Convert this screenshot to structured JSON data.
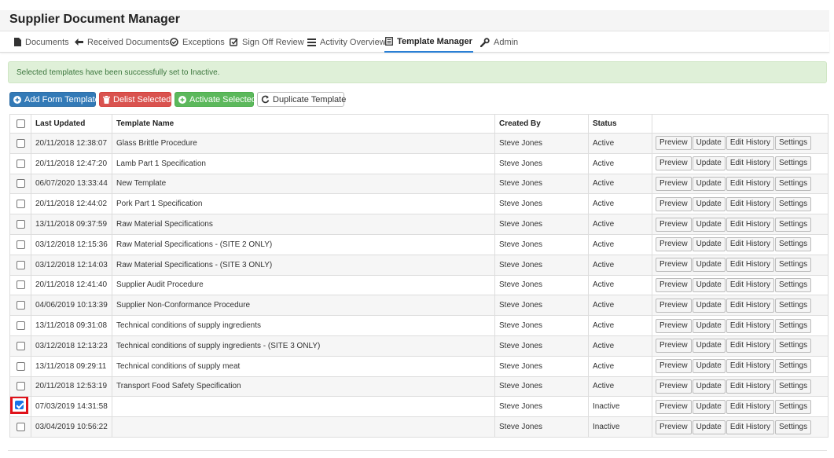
{
  "app": {
    "title": "Supplier Document Manager"
  },
  "nav": {
    "tabs": [
      {
        "label": "Documents",
        "icon": "file-icon"
      },
      {
        "label": "Received Documents",
        "icon": "arrow-left-icon"
      },
      {
        "label": "Exceptions",
        "icon": "circle-check-icon"
      },
      {
        "label": "Sign Off Review",
        "icon": "checkbox-icon"
      },
      {
        "label": "Activity Overview",
        "icon": "list-icon"
      },
      {
        "label": "Template Manager",
        "icon": "document-list-icon",
        "active": true
      },
      {
        "label": "Admin",
        "icon": "wrench-icon"
      }
    ]
  },
  "alert": {
    "message": "Selected templates have been successfully set to Inactive."
  },
  "toolbar": {
    "add_label": "Add Form Template",
    "delist_label": "Delist Selected",
    "activate_label": "Activate Selected",
    "duplicate_label": "Duplicate Template"
  },
  "table": {
    "headers": {
      "last_updated": "Last Updated",
      "template_name": "Template Name",
      "created_by": "Created By",
      "status": "Status"
    },
    "action_labels": {
      "preview": "Preview",
      "update": "Update",
      "edit_history": "Edit History",
      "settings": "Settings"
    },
    "rows": [
      {
        "checked": false,
        "last_updated": "20/11/2018 12:38:07",
        "template_name": "Glass Brittle Procedure",
        "created_by": "Steve Jones",
        "status": "Active"
      },
      {
        "checked": false,
        "last_updated": "20/11/2018 12:47:20",
        "template_name": "Lamb Part 1 Specification",
        "created_by": "Steve Jones",
        "status": "Active"
      },
      {
        "checked": false,
        "last_updated": "06/07/2020 13:33:44",
        "template_name": "New Template",
        "created_by": "Steve Jones",
        "status": "Active"
      },
      {
        "checked": false,
        "last_updated": "20/11/2018 12:44:02",
        "template_name": "Pork Part 1 Specification",
        "created_by": "Steve Jones",
        "status": "Active"
      },
      {
        "checked": false,
        "last_updated": "13/11/2018 09:37:59",
        "template_name": "Raw Material Specifications",
        "created_by": "Steve Jones",
        "status": "Active"
      },
      {
        "checked": false,
        "last_updated": "03/12/2018 12:15:36",
        "template_name": "Raw Material Specifications - (SITE 2 ONLY)",
        "created_by": "Steve Jones",
        "status": "Active"
      },
      {
        "checked": false,
        "last_updated": "03/12/2018 12:14:03",
        "template_name": "Raw Material Specifications - (SITE 3 ONLY)",
        "created_by": "Steve Jones",
        "status": "Active"
      },
      {
        "checked": false,
        "last_updated": "20/11/2018 12:41:40",
        "template_name": "Supplier Audit Procedure",
        "created_by": "Steve Jones",
        "status": "Active"
      },
      {
        "checked": false,
        "last_updated": "04/06/2019 10:13:39",
        "template_name": "Supplier Non-Conformance Procedure",
        "created_by": "Steve Jones",
        "status": "Active"
      },
      {
        "checked": false,
        "last_updated": "13/11/2018 09:31:08",
        "template_name": "Technical conditions of supply ingredients",
        "created_by": "Steve Jones",
        "status": "Active"
      },
      {
        "checked": false,
        "last_updated": "03/12/2018 12:13:23",
        "template_name": "Technical conditions of supply ingredients - (SITE 3 ONLY)",
        "created_by": "Steve Jones",
        "status": "Active"
      },
      {
        "checked": false,
        "last_updated": "13/11/2018 09:29:11",
        "template_name": "Technical conditions of supply meat",
        "created_by": "Steve Jones",
        "status": "Active"
      },
      {
        "checked": false,
        "last_updated": "20/11/2018 12:53:19",
        "template_name": "Transport Food Safety Specification",
        "created_by": "Steve Jones",
        "status": "Active"
      },
      {
        "checked": true,
        "highlight": true,
        "last_updated": "07/03/2019 14:31:58",
        "template_name": "",
        "created_by": "Steve Jones",
        "status": "Inactive"
      },
      {
        "checked": false,
        "last_updated": "03/04/2019 10:56:22",
        "template_name": "",
        "created_by": "Steve Jones",
        "status": "Inactive"
      }
    ]
  },
  "colors": {
    "primary": "#337ab7",
    "danger": "#d9534f",
    "success": "#5cb85c",
    "alert_bg": "#dff0d8",
    "alert_text": "#3c763d",
    "highlight": "#e0121a",
    "checkbox_checked": "#1a73e8"
  }
}
